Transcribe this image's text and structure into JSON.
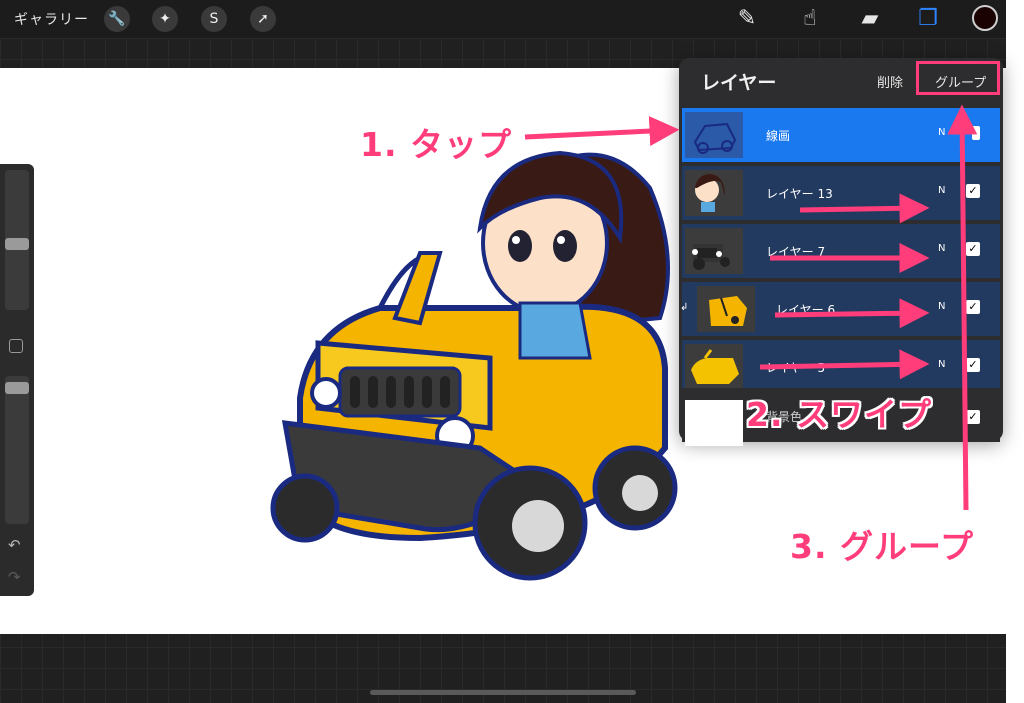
{
  "topbar": {
    "gallery_label": "ギャラリー",
    "left_tools": [
      {
        "name": "wrench-icon",
        "glyph": "🔧"
      },
      {
        "name": "magic-wand-icon",
        "glyph": "✦"
      },
      {
        "name": "selection-icon",
        "glyph": "S"
      },
      {
        "name": "transform-arrow-icon",
        "glyph": "➚"
      }
    ],
    "right_tools": [
      {
        "name": "brush-icon",
        "glyph": "✎"
      },
      {
        "name": "smudge-icon",
        "glyph": "☝"
      },
      {
        "name": "eraser-icon",
        "glyph": "▰"
      },
      {
        "name": "layers-icon",
        "glyph": "❐"
      }
    ],
    "current_color": "#1a0202"
  },
  "layers_panel": {
    "title": "レイヤー",
    "delete_label": "削除",
    "group_label": "グループ",
    "layers": [
      {
        "name": "線画",
        "blend": "N",
        "visible": true,
        "selected": true
      },
      {
        "name": "レイヤー 13",
        "blend": "N",
        "visible": true
      },
      {
        "name": "レイヤー 7",
        "blend": "N",
        "visible": true
      },
      {
        "name": "レイヤー 6",
        "blend": "N",
        "visible": true,
        "clipped": true
      },
      {
        "name": "レイヤー 5",
        "blend": "N",
        "visible": true
      },
      {
        "name": "背景色",
        "blend": "",
        "visible": true
      }
    ]
  },
  "sidebar": {
    "undo_glyph": "↶",
    "redo_glyph": "↷"
  },
  "annotations": {
    "step1": "1. タップ",
    "step2": "2. スワイプ",
    "step3": "3. グループ",
    "color": "#ff3d7a"
  },
  "colors": {
    "selected_layer": "#1a79ef",
    "layer_row": "#233a60",
    "panel": "#2d2d2f"
  }
}
